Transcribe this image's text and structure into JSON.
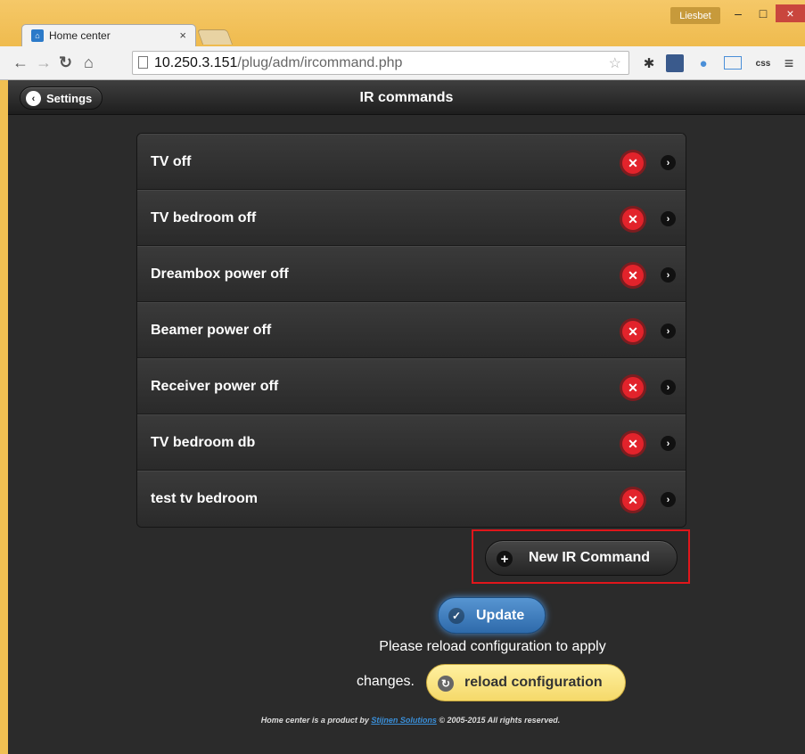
{
  "browser": {
    "tab_title": "Home center",
    "tab_close": "×",
    "profile_name": "Liesbet",
    "win_min": "–",
    "win_max": "□",
    "win_close": "×",
    "url_host": "10.250.3.151",
    "url_path": "/plug/adm/ircommand.php"
  },
  "header": {
    "back_label": "Settings",
    "title": "IR commands"
  },
  "commands": [
    {
      "label": "TV off"
    },
    {
      "label": "TV bedroom off"
    },
    {
      "label": "Dreambox power off"
    },
    {
      "label": "Beamer power off"
    },
    {
      "label": "Receiver power off"
    },
    {
      "label": "TV bedroom db"
    },
    {
      "label": "test tv bedroom"
    }
  ],
  "actions": {
    "new_label": "New IR Command",
    "update_label": "Update",
    "reload_text_1": "Please reload configuration to apply",
    "reload_text_2": "changes.",
    "reload_label": "reload configuration"
  },
  "footer": {
    "prefix": "Home center is a product by ",
    "link": "Stijnen Solutions",
    "suffix": " © 2005-2015 All rights reserved."
  },
  "colors": {
    "accent": "#f0c052",
    "delete": "#e2232b",
    "highlight_box": "#e1161b",
    "update": "#2e6aaa"
  }
}
